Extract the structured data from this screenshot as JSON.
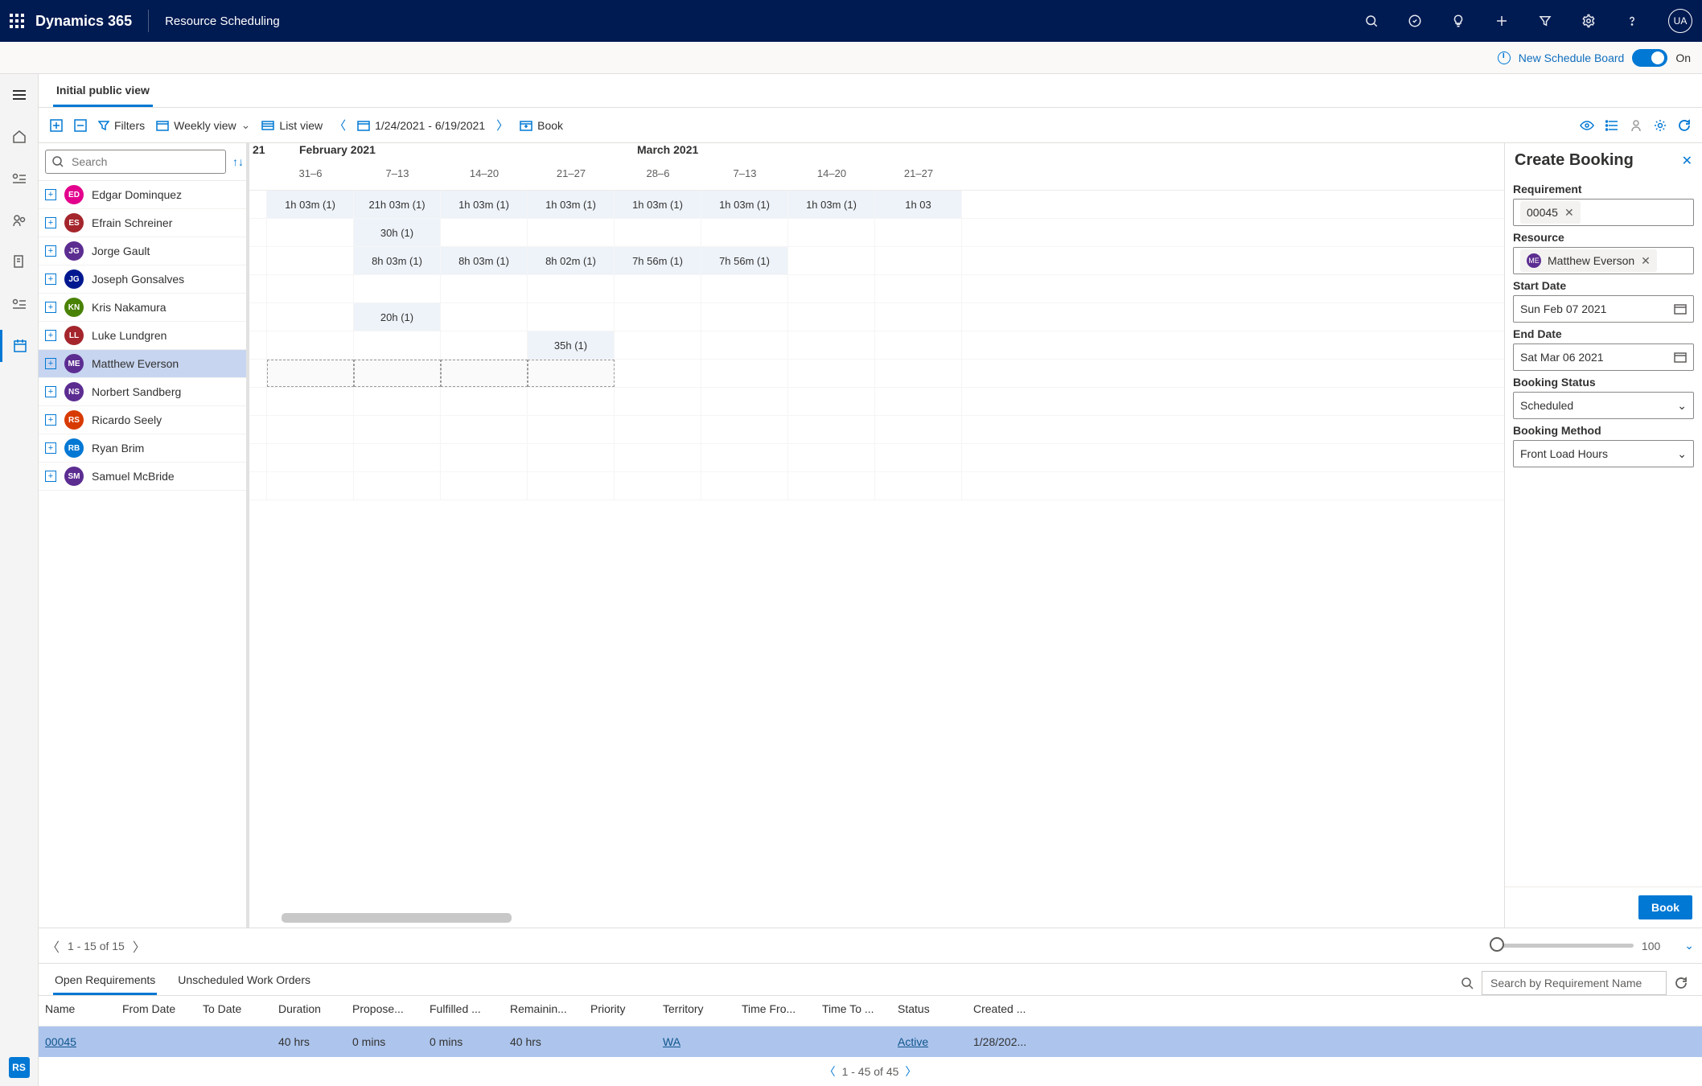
{
  "header": {
    "product": "Dynamics 365",
    "module": "Resource Scheduling",
    "user_initials": "UA",
    "new_board_label": "New Schedule Board",
    "toggle_on": "On"
  },
  "sidebar_bottom_tag": "RS",
  "view_tab": "Initial public view",
  "toolbar": {
    "filters": "Filters",
    "view_mode": "Weekly view",
    "list_view": "List view",
    "date_range": "1/24/2021 - 6/19/2021",
    "book": "Book"
  },
  "search_placeholder": "Search",
  "months": {
    "partial": "21",
    "m1": "February 2021",
    "m2": "March 2021"
  },
  "weeks": [
    "31–6",
    "7–13",
    "14–20",
    "21–27",
    "28–6",
    "7–13",
    "14–20",
    "21–27"
  ],
  "resources": [
    {
      "ini": "ED",
      "name": "Edgar Dominquez",
      "color": "#e3008c"
    },
    {
      "ini": "ES",
      "name": "Efrain Schreiner",
      "color": "#a4262c"
    },
    {
      "ini": "JG",
      "name": "Jorge Gault",
      "color": "#5c2d91"
    },
    {
      "ini": "JG",
      "name": "Joseph Gonsalves",
      "color": "#00188f"
    },
    {
      "ini": "KN",
      "name": "Kris Nakamura",
      "color": "#498205"
    },
    {
      "ini": "LL",
      "name": "Luke Lundgren",
      "color": "#a4262c"
    },
    {
      "ini": "ME",
      "name": "Matthew Everson",
      "color": "#5c2d91",
      "selected": true
    },
    {
      "ini": "NS",
      "name": "Norbert Sandberg",
      "color": "#5c2d91"
    },
    {
      "ini": "RS",
      "name": "Ricardo Seely",
      "color": "#d83b01"
    },
    {
      "ini": "RB",
      "name": "Ryan Brim",
      "color": "#0078d4"
    },
    {
      "ini": "SM",
      "name": "Samuel McBride",
      "color": "#5c2d91"
    }
  ],
  "grid": {
    "r0": [
      "1h 03m (1)",
      "21h 03m (1)",
      "1h 03m (1)",
      "1h 03m (1)",
      "1h 03m (1)",
      "1h 03m (1)",
      "1h 03m (1)",
      "1h 03"
    ],
    "r1_1": "30h (1)",
    "r2": [
      "8h 03m (1)",
      "8h 03m (1)",
      "8h 02m (1)",
      "7h 56m (1)",
      "7h 56m (1)"
    ],
    "r4_1": "20h (1)",
    "r5_3": "35h (1)"
  },
  "pager": {
    "text": "1 - 15 of 15",
    "zoom": "100"
  },
  "create_panel": {
    "title": "Create Booking",
    "requirement_label": "Requirement",
    "requirement_value": "00045",
    "resource_label": "Resource",
    "resource_value": "Matthew Everson",
    "resource_ini": "ME",
    "start_label": "Start Date",
    "start_value": "Sun Feb 07 2021",
    "end_label": "End Date",
    "end_value": "Sat Mar 06 2021",
    "status_label": "Booking Status",
    "status_value": "Scheduled",
    "method_label": "Booking Method",
    "method_value": "Front Load Hours",
    "book_btn": "Book"
  },
  "bottom": {
    "tab1": "Open Requirements",
    "tab2": "Unscheduled Work Orders",
    "search_ph": "Search by Requirement Name",
    "cols": [
      "Name",
      "From Date",
      "To Date",
      "Duration",
      "Propose...",
      "Fulfilled ...",
      "Remainin...",
      "Priority",
      "Territory",
      "Time Fro...",
      "Time To ...",
      "Status",
      "Created ..."
    ],
    "row": {
      "name": "00045",
      "duration": "40 hrs",
      "proposed": "0 mins",
      "fulfilled": "0 mins",
      "remaining": "40 hrs",
      "territory": "WA",
      "status": "Active",
      "created": "1/28/202..."
    },
    "pager": "1 - 45 of 45"
  }
}
